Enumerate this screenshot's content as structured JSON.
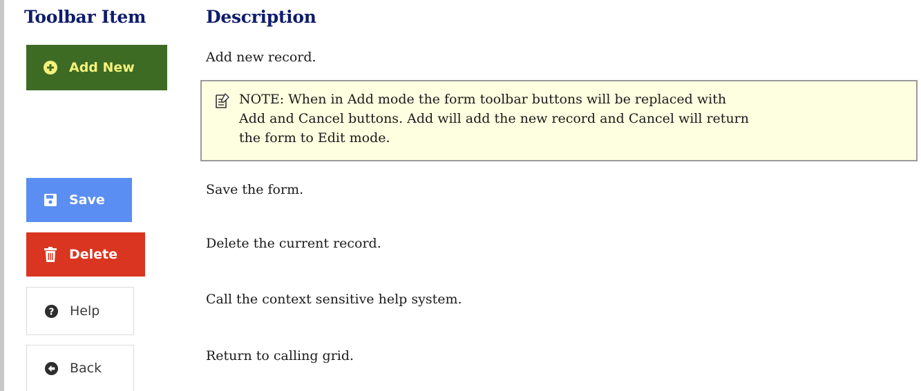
{
  "headers": {
    "item": "Toolbar Item",
    "description": "Description"
  },
  "rows": [
    {
      "button_label": "Add New",
      "icon": "plus-circle-icon",
      "description": "Add new record."
    },
    {
      "button_label": "Save",
      "icon": "floppy-disk-icon",
      "description": "Save the form."
    },
    {
      "button_label": "Delete",
      "icon": "trash-icon",
      "description": "Delete the current record."
    },
    {
      "button_label": "Help",
      "icon": "question-circle-icon",
      "description": "Call the context sensitive help system."
    },
    {
      "button_label": "Back",
      "icon": "arrow-left-circle-icon",
      "description": "Return to calling grid."
    }
  ],
  "note": {
    "icon": "note-icon",
    "text": "NOTE: When in Add mode the form toolbar buttons will be replaced with Add and Cancel buttons.  Add will add the new record and Cancel will return the form to Edit mode."
  },
  "colors": {
    "header": "#0f1c6b",
    "add_button_bg": "#3d6b24",
    "add_button_text": "#f5f17c",
    "save_button_bg": "#5b8ef2",
    "delete_button_bg": "#d93520",
    "note_bg": "#fefee0"
  }
}
